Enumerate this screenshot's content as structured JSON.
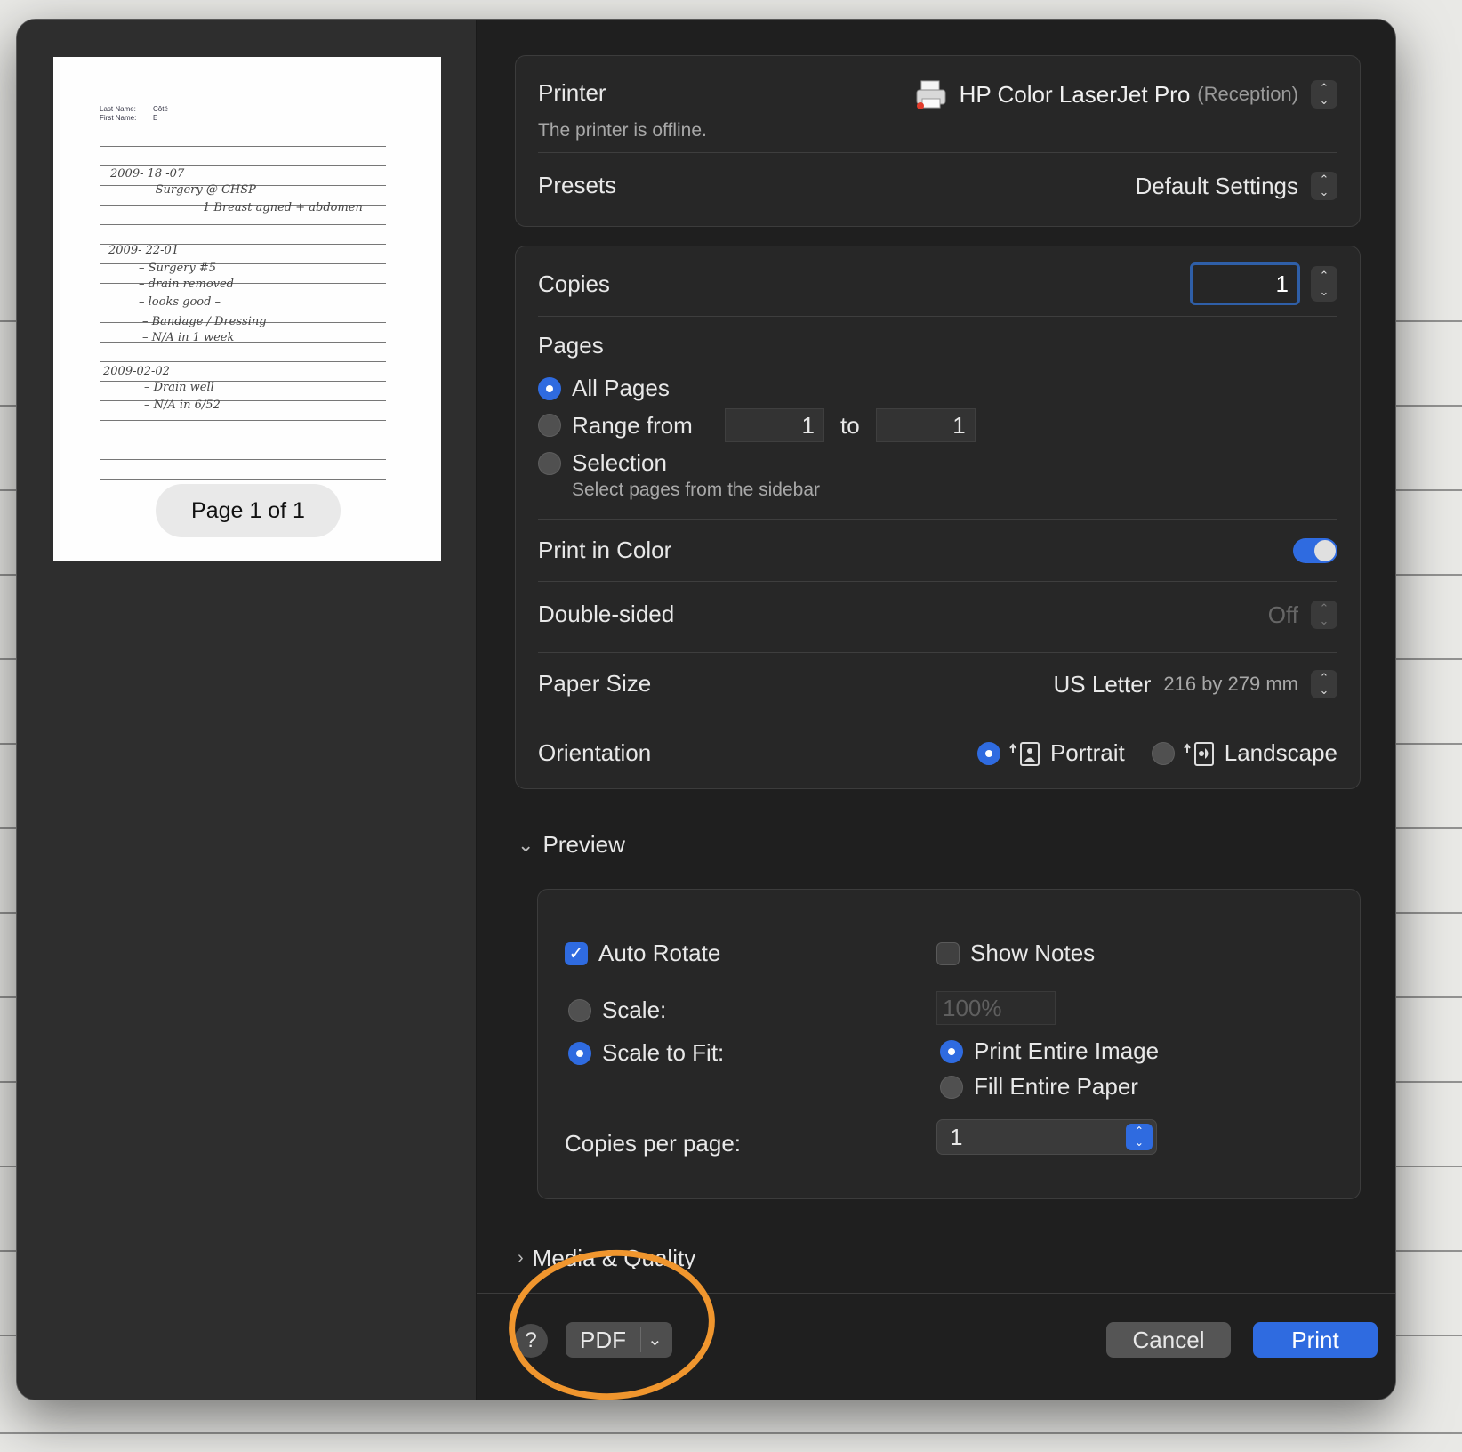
{
  "thumbnail": {
    "header_lines": [
      "Last Name:",
      "First Name:"
    ],
    "header_values": [
      "Côté",
      "E"
    ],
    "handwriting": [
      "2009- 18 -07",
      "– Surgery @ CHSP",
      "1 Breast agned + abdomen",
      "2009- 22-01",
      "– Surgery #5",
      "– drain removed",
      "– looks good –",
      "– Bandage / Dressing",
      "– N/A in 1 week",
      "2009-02-02",
      "– Drain well",
      "– N/A in 6/52"
    ],
    "page_indicator": "Page 1 of 1"
  },
  "printer_card": {
    "printer_label": "Printer",
    "printer_name": "HP Color LaserJet Pro",
    "printer_location": "(Reception)",
    "printer_status": "The printer is offline.",
    "presets_label": "Presets",
    "presets_value": "Default Settings"
  },
  "settings_card": {
    "copies_label": "Copies",
    "copies_value": "1",
    "pages_label": "Pages",
    "all_pages_label": "All Pages",
    "range_label": "Range from",
    "range_from": "1",
    "range_to_label": "to",
    "range_to": "1",
    "selection_label": "Selection",
    "selection_hint": "Select pages from the sidebar",
    "color_label": "Print in Color",
    "color_on": true,
    "double_sided_label": "Double-sided",
    "double_sided_value": "Off",
    "paper_size_label": "Paper Size",
    "paper_size_value": "US Letter",
    "paper_size_dims": "216 by 279 mm",
    "orientation_label": "Orientation",
    "portrait_label": "Portrait",
    "landscape_label": "Landscape"
  },
  "preview_section": {
    "title": "Preview",
    "auto_rotate_label": "Auto Rotate",
    "auto_rotate_checked": true,
    "show_notes_label": "Show Notes",
    "show_notes_checked": false,
    "scale_label": "Scale:",
    "scale_value": "100%",
    "scale_to_fit_label": "Scale to Fit:",
    "print_entire_image_label": "Print Entire Image",
    "fill_entire_paper_label": "Fill Entire Paper",
    "copies_per_page_label": "Copies per page:",
    "copies_per_page_value": "1"
  },
  "media_section": {
    "title": "Media & Quality"
  },
  "footer": {
    "help_label": "?",
    "pdf_label": "PDF",
    "cancel_label": "Cancel",
    "print_label": "Print"
  },
  "colors": {
    "accent": "#2f6be0",
    "annotation": "#f0962e",
    "dialog_bg": "#1f1f1f"
  },
  "icons": {
    "printer": "printer-icon",
    "stepper": "up-down-chevron-icon",
    "portrait": "portrait-orientation-icon",
    "landscape": "landscape-orientation-icon",
    "disclosure": "chevron-down-icon",
    "pdf_menu": "chevron-down-icon"
  }
}
